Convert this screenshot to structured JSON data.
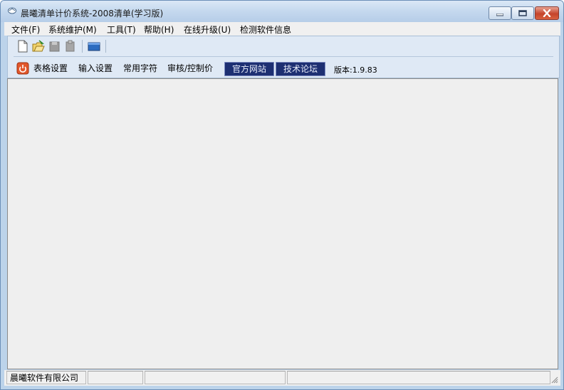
{
  "window": {
    "title": "晨曦清单计价系统-2008清单(学习版)",
    "icon": "app-icon"
  },
  "title_buttons": {
    "minimize": "minimize-icon",
    "maximize": "maximize-icon",
    "close": "close-icon"
  },
  "menu": {
    "items": [
      {
        "label": "文件(F)"
      },
      {
        "label": "系统维护(M)"
      },
      {
        "label": "工具(T)"
      },
      {
        "label": "帮助(H)"
      },
      {
        "label": "在线升级(U)"
      },
      {
        "label": "检测软件信息"
      }
    ]
  },
  "toolbar": {
    "icons": [
      "new-file-icon",
      "open-folder-icon",
      "save-icon",
      "clipboard-icon",
      "window-icon"
    ]
  },
  "quickbar": {
    "power_icon": "power-icon",
    "items": [
      {
        "label": "表格设置"
      },
      {
        "label": "输入设置"
      },
      {
        "label": "常用字符"
      },
      {
        "label": "审核/控制价"
      }
    ],
    "buttons": [
      {
        "label": "官方网站"
      },
      {
        "label": "技术论坛"
      }
    ],
    "version": "版本:1.9.83"
  },
  "colors": {
    "titlebar": "#c4d8ee",
    "dark_button": "#1d2f72",
    "client_bg": "#efefef",
    "close_button": "#c5442b"
  },
  "status": {
    "company": "晨曦软件有限公司",
    "cell2": "",
    "cell3": "",
    "cell4": ""
  }
}
